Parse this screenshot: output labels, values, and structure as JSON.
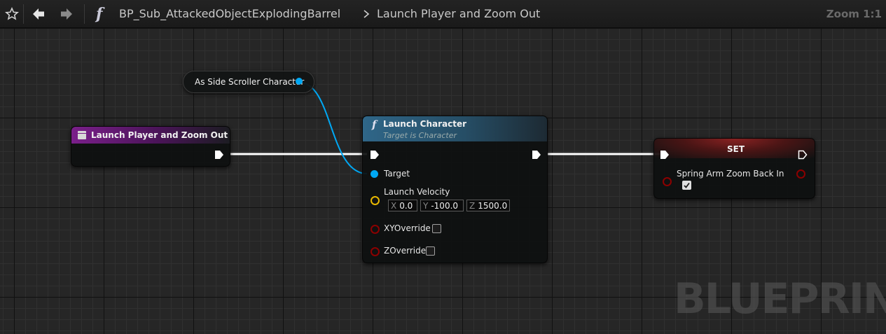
{
  "toolbar": {
    "breadcrumb_graph": "BP_Sub_AttackedObjectExplodingBarrel",
    "breadcrumb_function": "Launch Player and Zoom Out",
    "zoom": "Zoom 1:1",
    "icons": [
      "star-icon",
      "back-arrow-icon",
      "forward-arrow-icon",
      "function-icon",
      "chevron-right-icon"
    ]
  },
  "watermark": "BLUEPRINT",
  "colors": {
    "exec_wire": "#ffffff",
    "object_pin": "#00a8f4",
    "vector_pin": "#e8b800",
    "bool_pin": "#8c0000",
    "event_header": "#7a1f8a",
    "function_header": "#2f6688",
    "set_header": "#7a1a1a"
  },
  "nodes": {
    "cast": {
      "label": "As Side Scroller Character"
    },
    "entry": {
      "title": "Launch Player and Zoom Out"
    },
    "launch": {
      "title": "Launch Character",
      "subtitle": "Target is Character",
      "pins": {
        "target": "Target",
        "velocity": "Launch Velocity",
        "xy_override": "XYOverride",
        "z_override": "ZOverride"
      },
      "velocity": {
        "x_label": "X",
        "x": "0.0",
        "y_label": "Y",
        "y": "-100.0",
        "z_label": "Z",
        "z": "1500.0"
      },
      "xy_override_checked": false,
      "z_override_checked": false
    },
    "set": {
      "title": "SET",
      "pin": "Spring Arm Zoom Back In",
      "checked": true
    }
  }
}
